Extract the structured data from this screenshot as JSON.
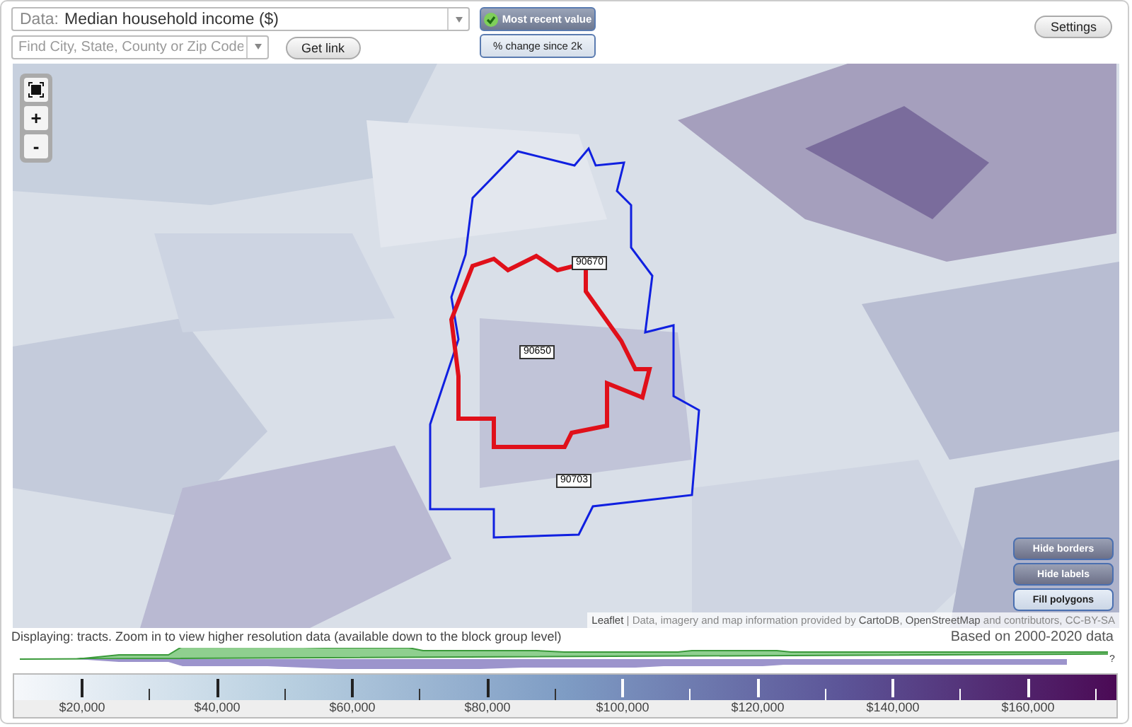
{
  "data_select": {
    "label": "Data:",
    "value": "Median household income ($)"
  },
  "search": {
    "placeholder": "Find City, State, County or Zip Code"
  },
  "get_link": "Get link",
  "view_modes": [
    {
      "label": "Most recent value",
      "selected": true
    },
    {
      "label": "% change since 2k",
      "selected": false
    }
  ],
  "settings": "Settings",
  "map": {
    "zoom_controls": [
      "+",
      "-"
    ],
    "zip_labels": [
      "90670",
      "90650",
      "90703"
    ],
    "toggles": [
      {
        "label": "Hide borders",
        "on": true
      },
      {
        "label": "Hide labels",
        "on": true
      },
      {
        "label": "Fill polygons",
        "on": false
      }
    ],
    "attribution": {
      "link": "Leaflet",
      "text": "| Data, imagery and map information provided by **CartoDB**, **OpenStreetMap** and contributors, CC-BY-SA"
    }
  },
  "status": "Displaying: tracts. Zoom in to view higher resolution data (available down to the block group level)",
  "basis": "Based on 2000-2020 data",
  "histogram_mark": "?",
  "legend": {
    "labels": [
      "$20,000",
      "$40,000",
      "$60,000",
      "$80,000",
      "$100,000",
      "$120,000",
      "$140,000",
      "$160,000"
    ]
  }
}
